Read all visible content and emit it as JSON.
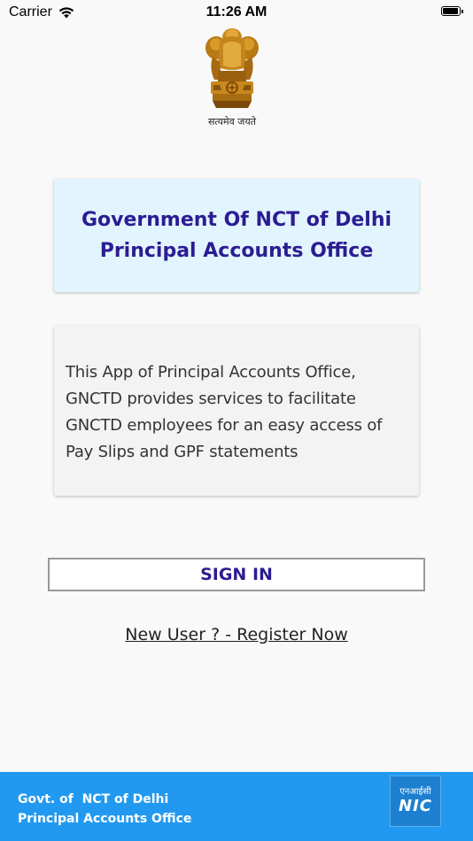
{
  "status_bar": {
    "carrier": "Carrier",
    "time": "11:26 AM",
    "wifi_icon": "wifi-icon",
    "battery_icon": "battery-icon"
  },
  "emblem": {
    "icon": "national-emblem-icon",
    "motto": "सत्यमेव जयते"
  },
  "title_card": {
    "line1": "Government Of NCT of Delhi",
    "line2": "Principal Accounts Office",
    "background": "#e2f4fe",
    "text_color": "#2c1c92"
  },
  "description": {
    "text": "This App of Principal Accounts Office, GNCTD provides services to facilitate GNCTD employees for an easy access of Pay Slips and GPF statements"
  },
  "signin": {
    "label": "SIGN IN"
  },
  "register": {
    "label": "New User ? - Register Now"
  },
  "footer": {
    "line1": "Govt. of  NCT of Delhi",
    "line2": "Principal Accounts Office",
    "background": "#2299f0",
    "logo": {
      "icon": "nic-logo-icon",
      "hindi": "एनआईसी",
      "english": "NIC"
    }
  }
}
